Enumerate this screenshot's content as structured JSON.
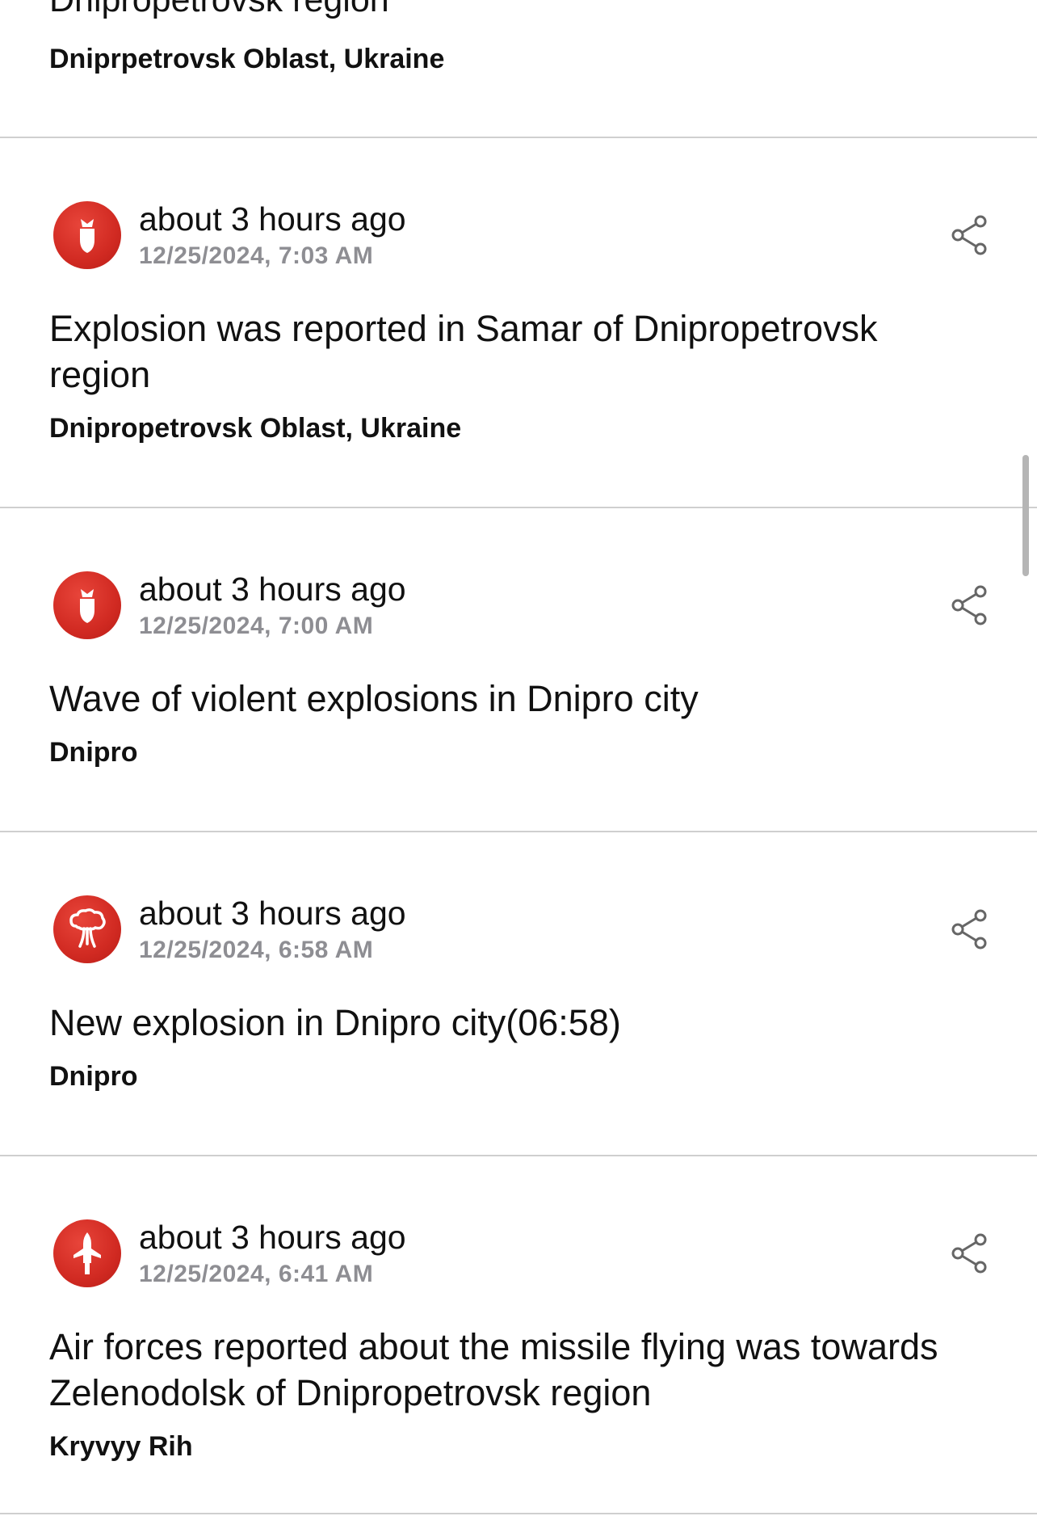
{
  "top_partial": {
    "title": "Dnipropetrovsk region",
    "location": "Dniprpetrovsk Oblast, Ukraine"
  },
  "events": [
    {
      "icon": "bomb-icon",
      "relative_time": "about 3 hours ago",
      "timestamp": "12/25/2024, 7:03 AM",
      "headline": "Explosion was reported in Samar of Dnipropetrovsk region",
      "location": "Dnipropetrovsk Oblast, Ukraine"
    },
    {
      "icon": "bomb-icon",
      "relative_time": "about 3 hours ago",
      "timestamp": "12/25/2024, 7:00 AM",
      "headline": "Wave of violent explosions in Dnipro city",
      "location": "Dnipro"
    },
    {
      "icon": "explosion-cloud-icon",
      "relative_time": "about 3 hours ago",
      "timestamp": "12/25/2024, 6:58 AM",
      "headline": "New explosion in Dnipro city(06:58)",
      "location": "Dnipro"
    },
    {
      "icon": "missile-icon",
      "relative_time": "about 3 hours ago",
      "timestamp": "12/25/2024, 6:41 AM",
      "headline": "Air forces reported about the missile flying was towards Zelenodolsk of Dnipropetrovsk region",
      "location": "Kryvyy Rih"
    }
  ],
  "share_icon": "share-icon",
  "colors": {
    "icon_red": "#d12a22",
    "divider": "#cfcfcf",
    "timestamp_gray": "#8e8e93",
    "scrollbar": "#b5b5b5"
  }
}
